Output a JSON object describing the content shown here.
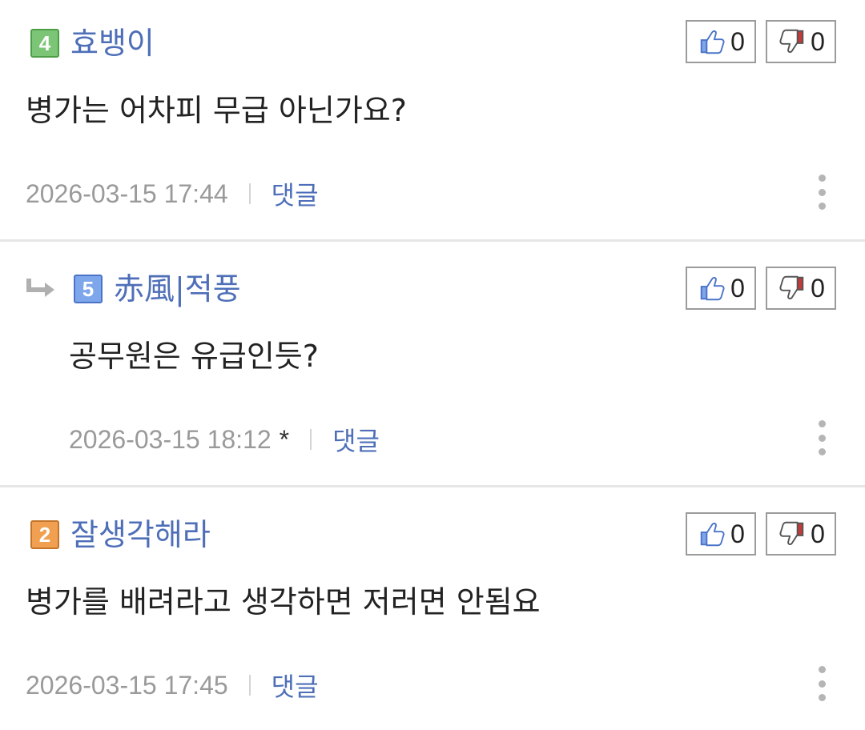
{
  "comments": [
    {
      "level": "4",
      "nickname": "효뱅이",
      "upvotes": "0",
      "downvotes": "0",
      "text": "병가는 어차피 무급 아닌가요?",
      "date": "2026-03-15 17:44",
      "edited_mark": "",
      "reply_label": "댓글",
      "is_reply": false
    },
    {
      "level": "5",
      "nickname": "赤風|적풍",
      "upvotes": "0",
      "downvotes": "0",
      "text": "공무원은 유급인듯?",
      "date": "2026-03-15 18:12",
      "edited_mark": "*",
      "reply_label": "댓글",
      "is_reply": true
    },
    {
      "level": "2",
      "nickname": "잘생각해라",
      "upvotes": "0",
      "downvotes": "0",
      "text": "병가를 배려라고 생각하면 저러면 안됨요",
      "date": "2026-03-15 17:45",
      "edited_mark": "",
      "reply_label": "댓글",
      "is_reply": false
    }
  ],
  "colors": {
    "nickname": "#4e6fb8",
    "reply_link": "#4e6fb8",
    "meta_text": "#9a9a9a",
    "divider": "#e6e6e6",
    "thumb_up": "#4a73c9",
    "thumb_down": "#c43a3a"
  },
  "icons": {
    "upvote": "thumbs-up-icon",
    "downvote": "thumbs-down-icon",
    "more": "more-vertical-icon",
    "reply_arrow": "reply-arrow-icon"
  }
}
